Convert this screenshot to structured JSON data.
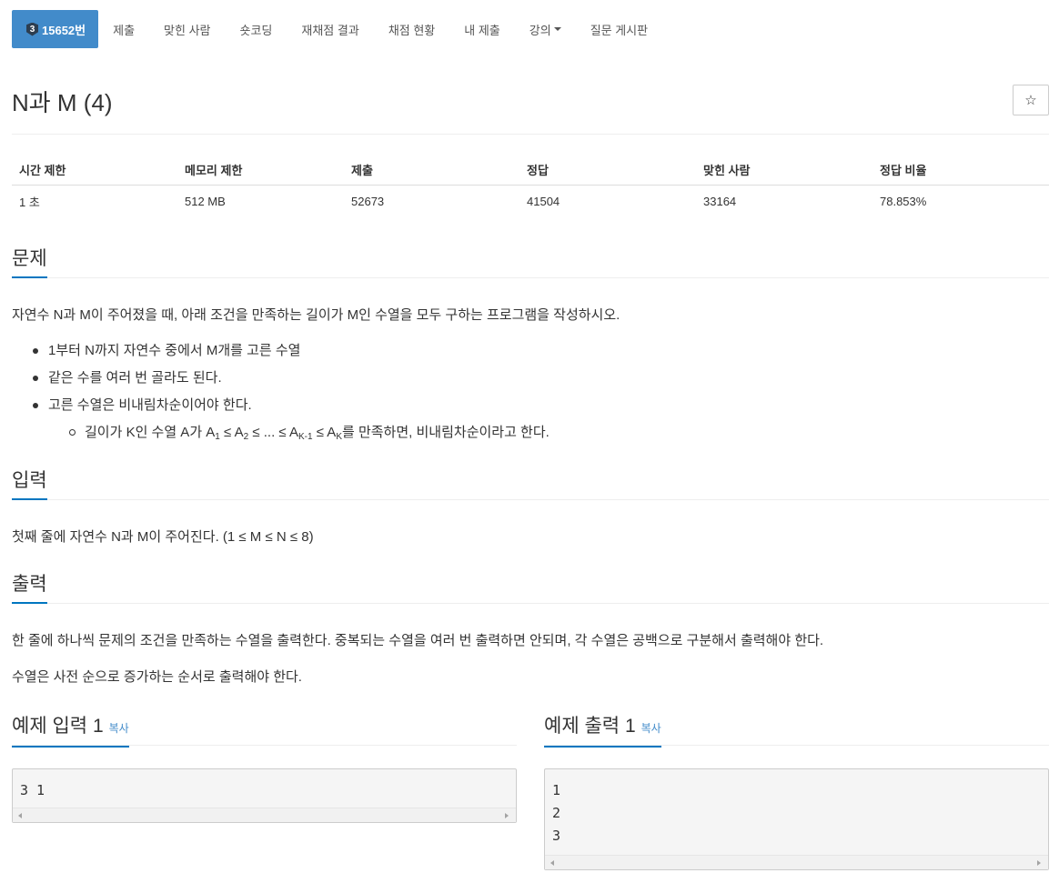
{
  "nav": {
    "tier": "3",
    "problem_id": "15652번",
    "items": [
      "제출",
      "맞힌 사람",
      "숏코딩",
      "재채점 결과",
      "채점 현황",
      "내 제출",
      "강의",
      "질문 게시판"
    ]
  },
  "problem": {
    "title": "N과 M (4)",
    "star": "☆"
  },
  "stats": {
    "headers": [
      "시간 제한",
      "메모리 제한",
      "제출",
      "정답",
      "맞힌 사람",
      "정답 비율"
    ],
    "values": [
      "1 초",
      "512 MB",
      "52673",
      "41504",
      "33164",
      "78.853%"
    ]
  },
  "sections": {
    "problem_heading": "문제",
    "problem_text": "자연수 N과 M이 주어졌을 때, 아래 조건을 만족하는 길이가 M인 수열을 모두 구하는 프로그램을 작성하시오.",
    "conditions": [
      "1부터 N까지 자연수 중에서 M개를 고른 수열",
      "같은 수를 여러 번 골라도 된다.",
      "고른 수열은 비내림차순이어야 한다."
    ],
    "subcondition": {
      "prefix": "길이가 K인 수열 A가 A",
      "s1": "1",
      "m1": " ≤ A",
      "s2": "2",
      "m2": " ≤ ... ≤ A",
      "s3": "K-1",
      "m3": " ≤ A",
      "s4": "K",
      "suffix": "를 만족하면, 비내림차순이라고 한다."
    },
    "input_heading": "입력",
    "input_text": "첫째 줄에 자연수 N과 M이 주어진다. (1 ≤ M ≤ N ≤ 8)",
    "output_heading": "출력",
    "output_text1": "한 줄에 하나씩 문제의 조건을 만족하는 수열을 출력한다. 중복되는 수열을 여러 번 출력하면 안되며, 각 수열은 공백으로 구분해서 출력해야 한다.",
    "output_text2": "수열은 사전 순으로 증가하는 순서로 출력해야 한다."
  },
  "samples": {
    "input_heading": "예제 입력 1",
    "output_heading": "예제 출력 1",
    "copy_label": "복사",
    "input": "3 1",
    "output": "1\n2\n3"
  }
}
